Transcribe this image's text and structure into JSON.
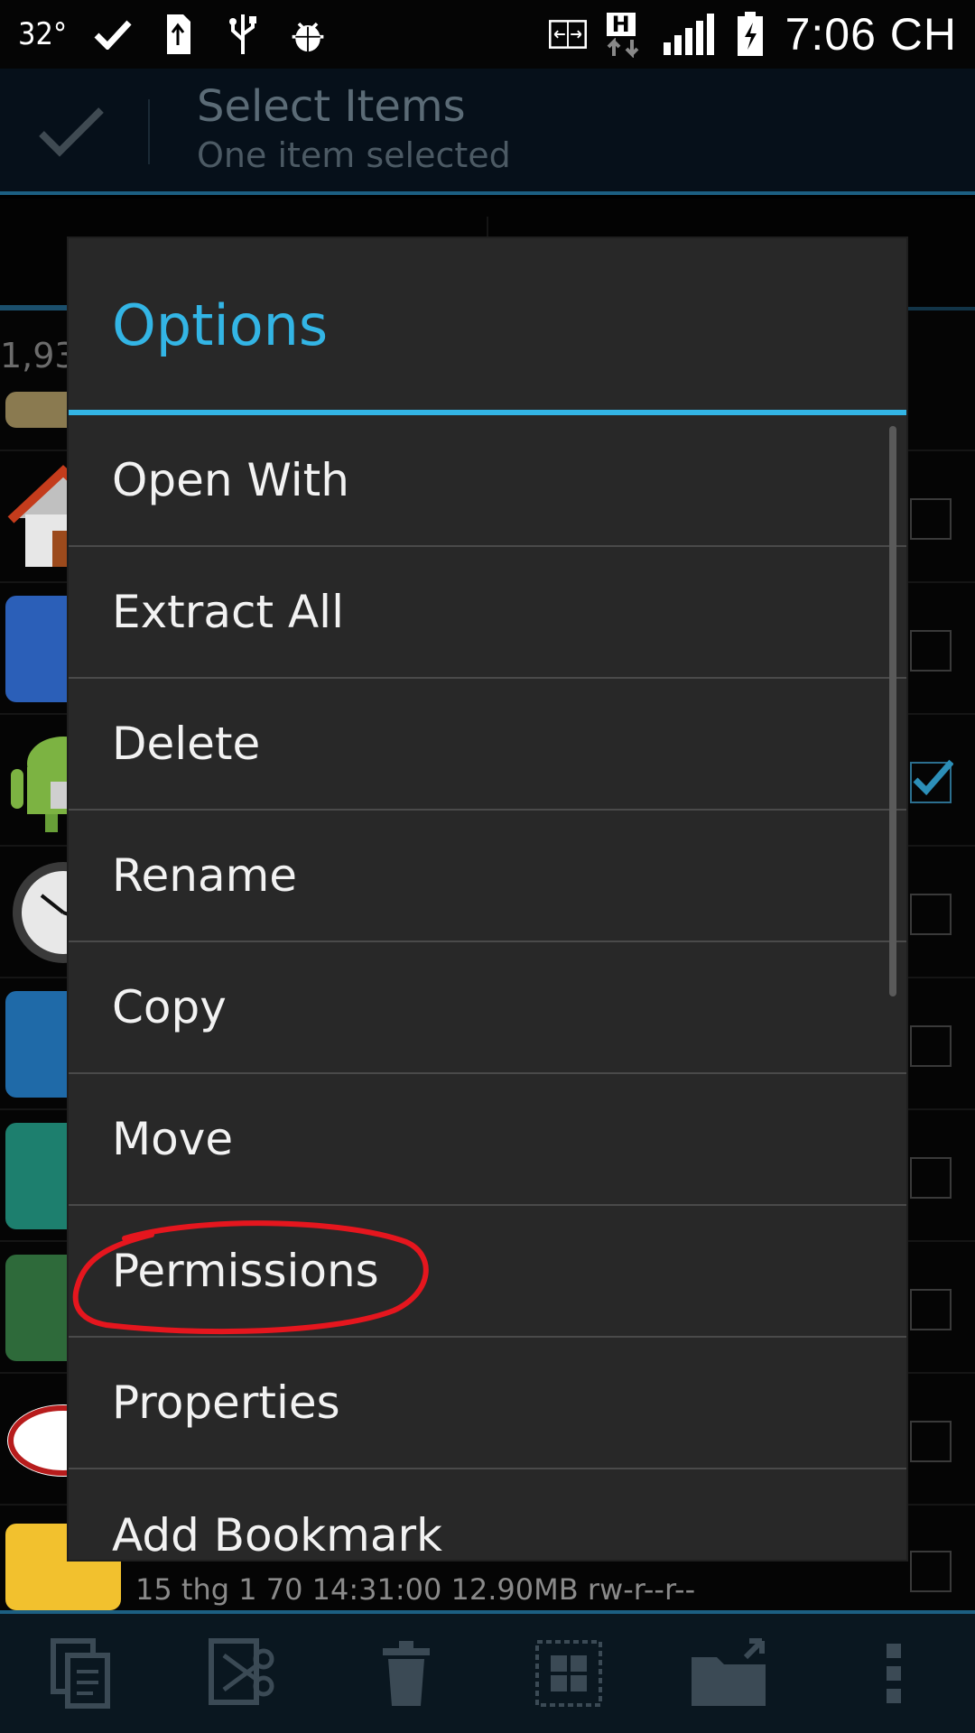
{
  "status_bar": {
    "temperature": "32°",
    "time": "7:06 CH",
    "network_badge": "H"
  },
  "action_bar": {
    "title": "Select Items",
    "subtitle": "One item selected"
  },
  "list": {
    "count_partial": "1,93",
    "last_item_meta": "15 thg 1 70 14:31:00  12.90MB  rw-r--r--"
  },
  "dialog": {
    "title": "Options",
    "items": [
      {
        "label": "Open With"
      },
      {
        "label": "Extract All"
      },
      {
        "label": "Delete"
      },
      {
        "label": "Rename"
      },
      {
        "label": "Copy"
      },
      {
        "label": "Move"
      },
      {
        "label": "Permissions"
      },
      {
        "label": "Properties"
      },
      {
        "label": "Add Bookmark"
      }
    ]
  },
  "colors": {
    "accent": "#33b5e5",
    "dialog_bg": "#282828",
    "annotation": "#e5161e"
  }
}
